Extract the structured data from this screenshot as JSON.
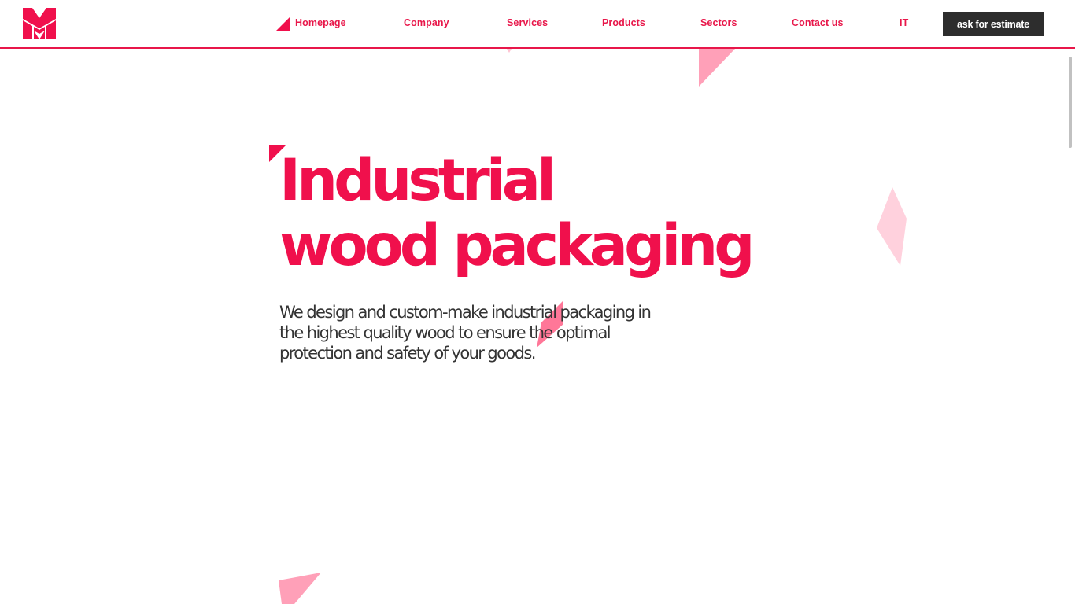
{
  "brand": {
    "accent_color": "#e8174a",
    "logo_icon": "m-logo-icon"
  },
  "nav": {
    "items": [
      {
        "label": "Homepage",
        "active": true
      },
      {
        "label": "Company"
      },
      {
        "label": "Services"
      },
      {
        "label": "Products"
      },
      {
        "label": "Sectors"
      },
      {
        "label": "Contact us"
      },
      {
        "label": "IT"
      }
    ],
    "cta_label": "ask for estimate"
  },
  "hero": {
    "title_line1": "Industrial",
    "title_line2": "wood packaging",
    "subtitle": "We design and custom-make industrial packaging in the highest quality wood to ensure the optimal protection and safety of your goods."
  }
}
